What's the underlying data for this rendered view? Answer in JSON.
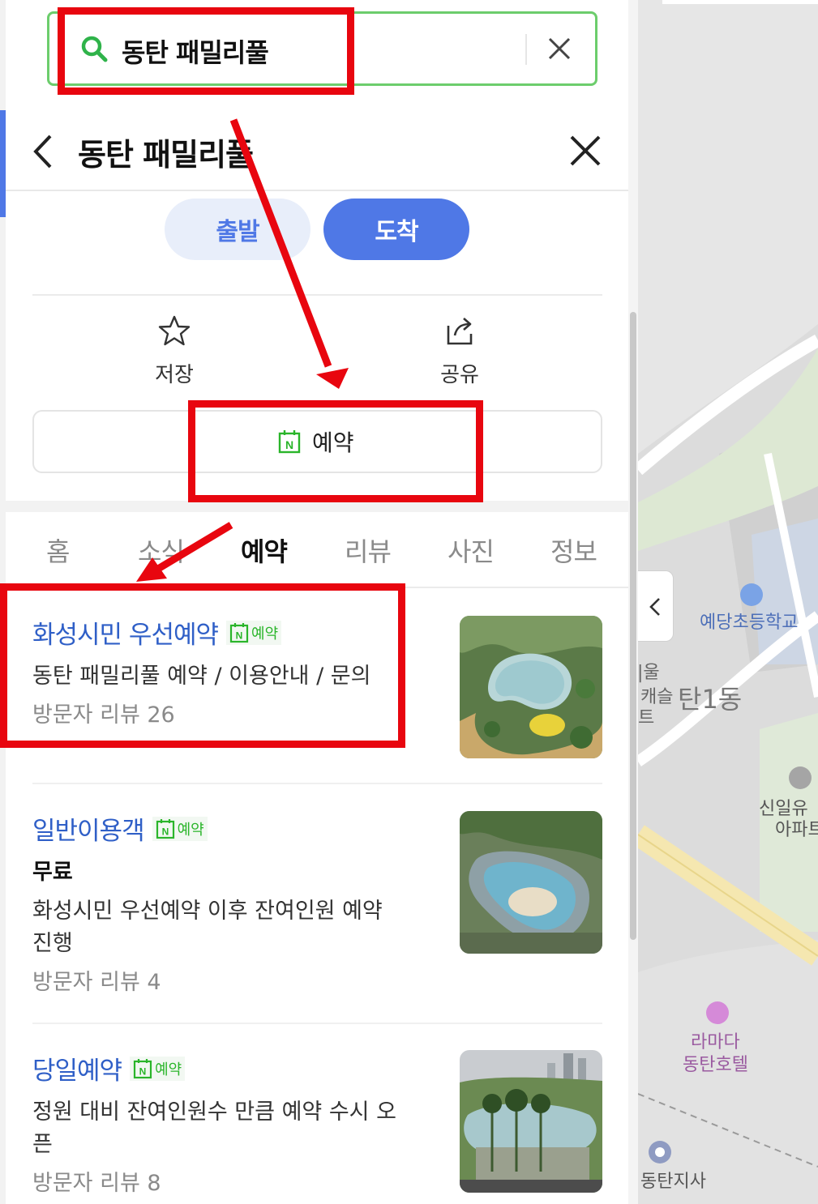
{
  "search": {
    "query": "동탄 패밀리풀"
  },
  "header": {
    "title": "동탄 패밀리풀"
  },
  "route": {
    "depart_label": "출발",
    "arrive_label": "도착"
  },
  "actions": {
    "save_label": "저장",
    "share_label": "공유"
  },
  "reserve": {
    "label": "예약"
  },
  "tabs": [
    {
      "label": "홈"
    },
    {
      "label": "소식"
    },
    {
      "label": "예약",
      "active": true
    },
    {
      "label": "리뷰"
    },
    {
      "label": "사진"
    },
    {
      "label": "정보"
    }
  ],
  "items": [
    {
      "title": "화성시민 우선예약",
      "badge": "예약",
      "lines": [
        "동탄 패밀리풀 예약 / 이용안내 / 문의"
      ],
      "review": "방문자 리뷰 26"
    },
    {
      "title": "일반이용객",
      "badge": "예약",
      "price": "무료",
      "lines": [
        "화성시민 우선예약 이후 잔여인원 예약",
        "진행"
      ],
      "review": "방문자 리뷰 4"
    },
    {
      "title": "당일예약",
      "badge": "예약",
      "lines": [
        "정원 대비 잔여인원수 만큼 예약 수시 오",
        "픈"
      ],
      "review": "방문자 리뷰 8"
    }
  ],
  "map": {
    "labels": {
      "school": "예당초등학교",
      "dong": "탄1동",
      "partial_1": "|울",
      "partial_2": "캐슬",
      "partial_3": "트",
      "apt_1": "신일유",
      "apt_2": "아파트",
      "hotel_1": "라마다",
      "hotel_2": "동탄호텔",
      "office": "동탄지사"
    }
  },
  "colors": {
    "accent_blue": "#4f78e6",
    "search_border_green": "#6ccd6c",
    "naver_green": "#2ab52a",
    "annotation_red": "#e8060f",
    "title_link_blue": "#2f5fc7"
  }
}
